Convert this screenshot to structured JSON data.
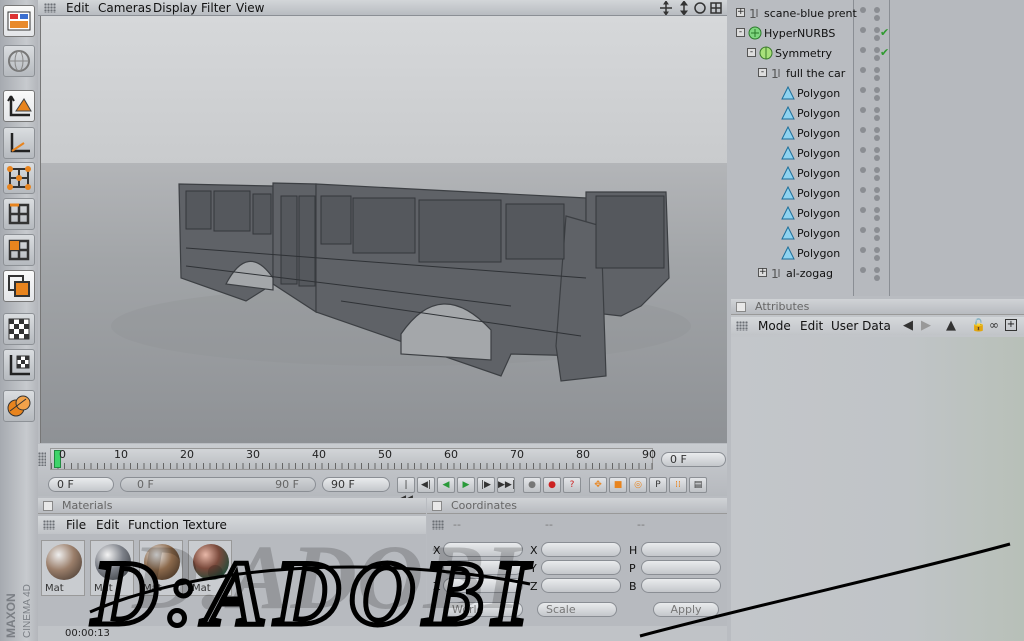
{
  "viewport_menu": [
    "Edit",
    "Cameras",
    "Display",
    "Filter",
    "View"
  ],
  "timeline": {
    "ticks": [
      "0",
      "10",
      "20",
      "30",
      "40",
      "50",
      "60",
      "70",
      "80",
      "90"
    ],
    "current_frame_field": "0 F",
    "start_field": "0 F",
    "range_start": "0 F",
    "range_end": "90 F",
    "end_field": "90 F"
  },
  "materials": {
    "title": "Materials",
    "menu": [
      "File",
      "Edit",
      "Function",
      "Texture"
    ],
    "items": [
      {
        "label": "Mat"
      },
      {
        "label": "Mat"
      },
      {
        "label": "Mat"
      },
      {
        "label": "Mat"
      }
    ]
  },
  "coordinates": {
    "title": "Coordinates",
    "columns": [
      "--",
      "--",
      "--"
    ],
    "axis_labels": [
      "X",
      "Y",
      "Z"
    ],
    "rot_labels": [
      "H",
      "P",
      "B"
    ],
    "mode_select": "World",
    "scale_select": "Scale",
    "apply_label": "Apply"
  },
  "object_manager": {
    "objects": [
      {
        "name": "scane-blue prent",
        "indent": 0,
        "expander": "+",
        "icon": "null-icon",
        "checked": false
      },
      {
        "name": "HyperNURBS",
        "indent": 0,
        "expander": "-",
        "icon": "hypernurbs-icon",
        "checked": true
      },
      {
        "name": "Symmetry",
        "indent": 1,
        "expander": "-",
        "icon": "symmetry-icon",
        "checked": true
      },
      {
        "name": "full the car",
        "indent": 2,
        "expander": "-",
        "icon": "null-icon",
        "checked": false
      },
      {
        "name": "Polygon",
        "indent": 3,
        "expander": "",
        "icon": "polygon-icon",
        "checked": false
      },
      {
        "name": "Polygon",
        "indent": 3,
        "expander": "",
        "icon": "polygon-icon",
        "checked": false
      },
      {
        "name": "Polygon",
        "indent": 3,
        "expander": "",
        "icon": "polygon-icon",
        "checked": false
      },
      {
        "name": "Polygon",
        "indent": 3,
        "expander": "",
        "icon": "polygon-icon",
        "checked": false
      },
      {
        "name": "Polygon",
        "indent": 3,
        "expander": "",
        "icon": "polygon-icon",
        "checked": false
      },
      {
        "name": "Polygon",
        "indent": 3,
        "expander": "",
        "icon": "polygon-icon",
        "checked": false
      },
      {
        "name": "Polygon",
        "indent": 3,
        "expander": "",
        "icon": "polygon-icon",
        "checked": false
      },
      {
        "name": "Polygon",
        "indent": 3,
        "expander": "",
        "icon": "polygon-icon",
        "checked": false
      },
      {
        "name": "Polygon",
        "indent": 3,
        "expander": "",
        "icon": "polygon-icon",
        "checked": false
      },
      {
        "name": "al-zogag",
        "indent": 2,
        "expander": "+",
        "icon": "null-icon",
        "checked": false
      }
    ]
  },
  "attributes": {
    "title": "Attributes",
    "menu": [
      "Mode",
      "Edit",
      "User Data"
    ]
  },
  "branding": {
    "line1": "MAXON",
    "line2": "CINEMA 4D"
  },
  "status": {
    "time": "00:00:13"
  },
  "watermark": {
    "text": "D:ADOBI"
  }
}
